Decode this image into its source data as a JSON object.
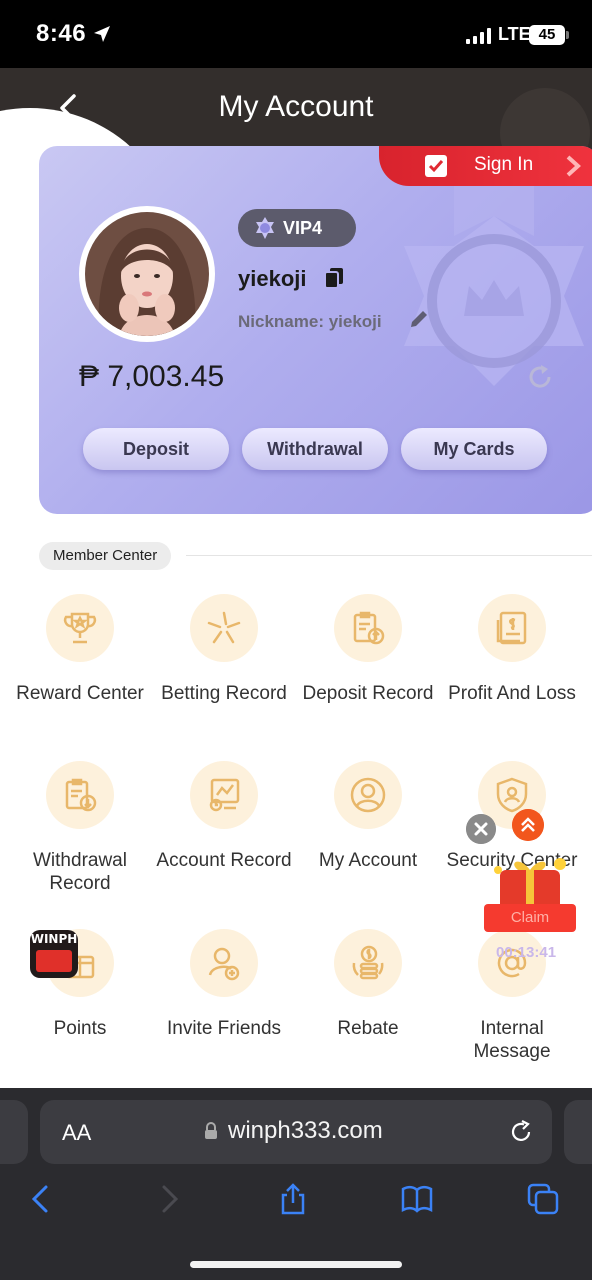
{
  "status_bar": {
    "time": "8:46",
    "network": "LTE",
    "battery": "45"
  },
  "header": {
    "title": "My Account"
  },
  "account": {
    "sign_in_label": "Sign In",
    "vip_level": "VIP4",
    "username": "yiekoji",
    "nickname": "Nickname: yiekoji",
    "balance": "₱ 7,003.45",
    "buttons": {
      "deposit": "Deposit",
      "withdrawal": "Withdrawal",
      "my_cards": "My Cards"
    }
  },
  "member_center": {
    "title": "Member Center",
    "items": [
      {
        "label": "Reward Center"
      },
      {
        "label": "Betting Record"
      },
      {
        "label": "Deposit Record"
      },
      {
        "label": "Profit And Loss"
      },
      {
        "label": "Withdrawal Record"
      },
      {
        "label": "Account Record"
      },
      {
        "label": "My Account"
      },
      {
        "label": "Security Center"
      },
      {
        "label": "Points"
      },
      {
        "label": "Invite Friends"
      },
      {
        "label": "Rebate"
      },
      {
        "label": "Internal Message"
      }
    ]
  },
  "floating": {
    "claim_label": "Claim",
    "countdown": "00:13:41",
    "logo_text": "WINPH"
  },
  "browser": {
    "text_size": "AA",
    "url": "winph333.com"
  },
  "colors": {
    "accent_red": "#e8222d",
    "card_purple": "#a9a6ec",
    "icon_tint": "#e8b76a"
  }
}
